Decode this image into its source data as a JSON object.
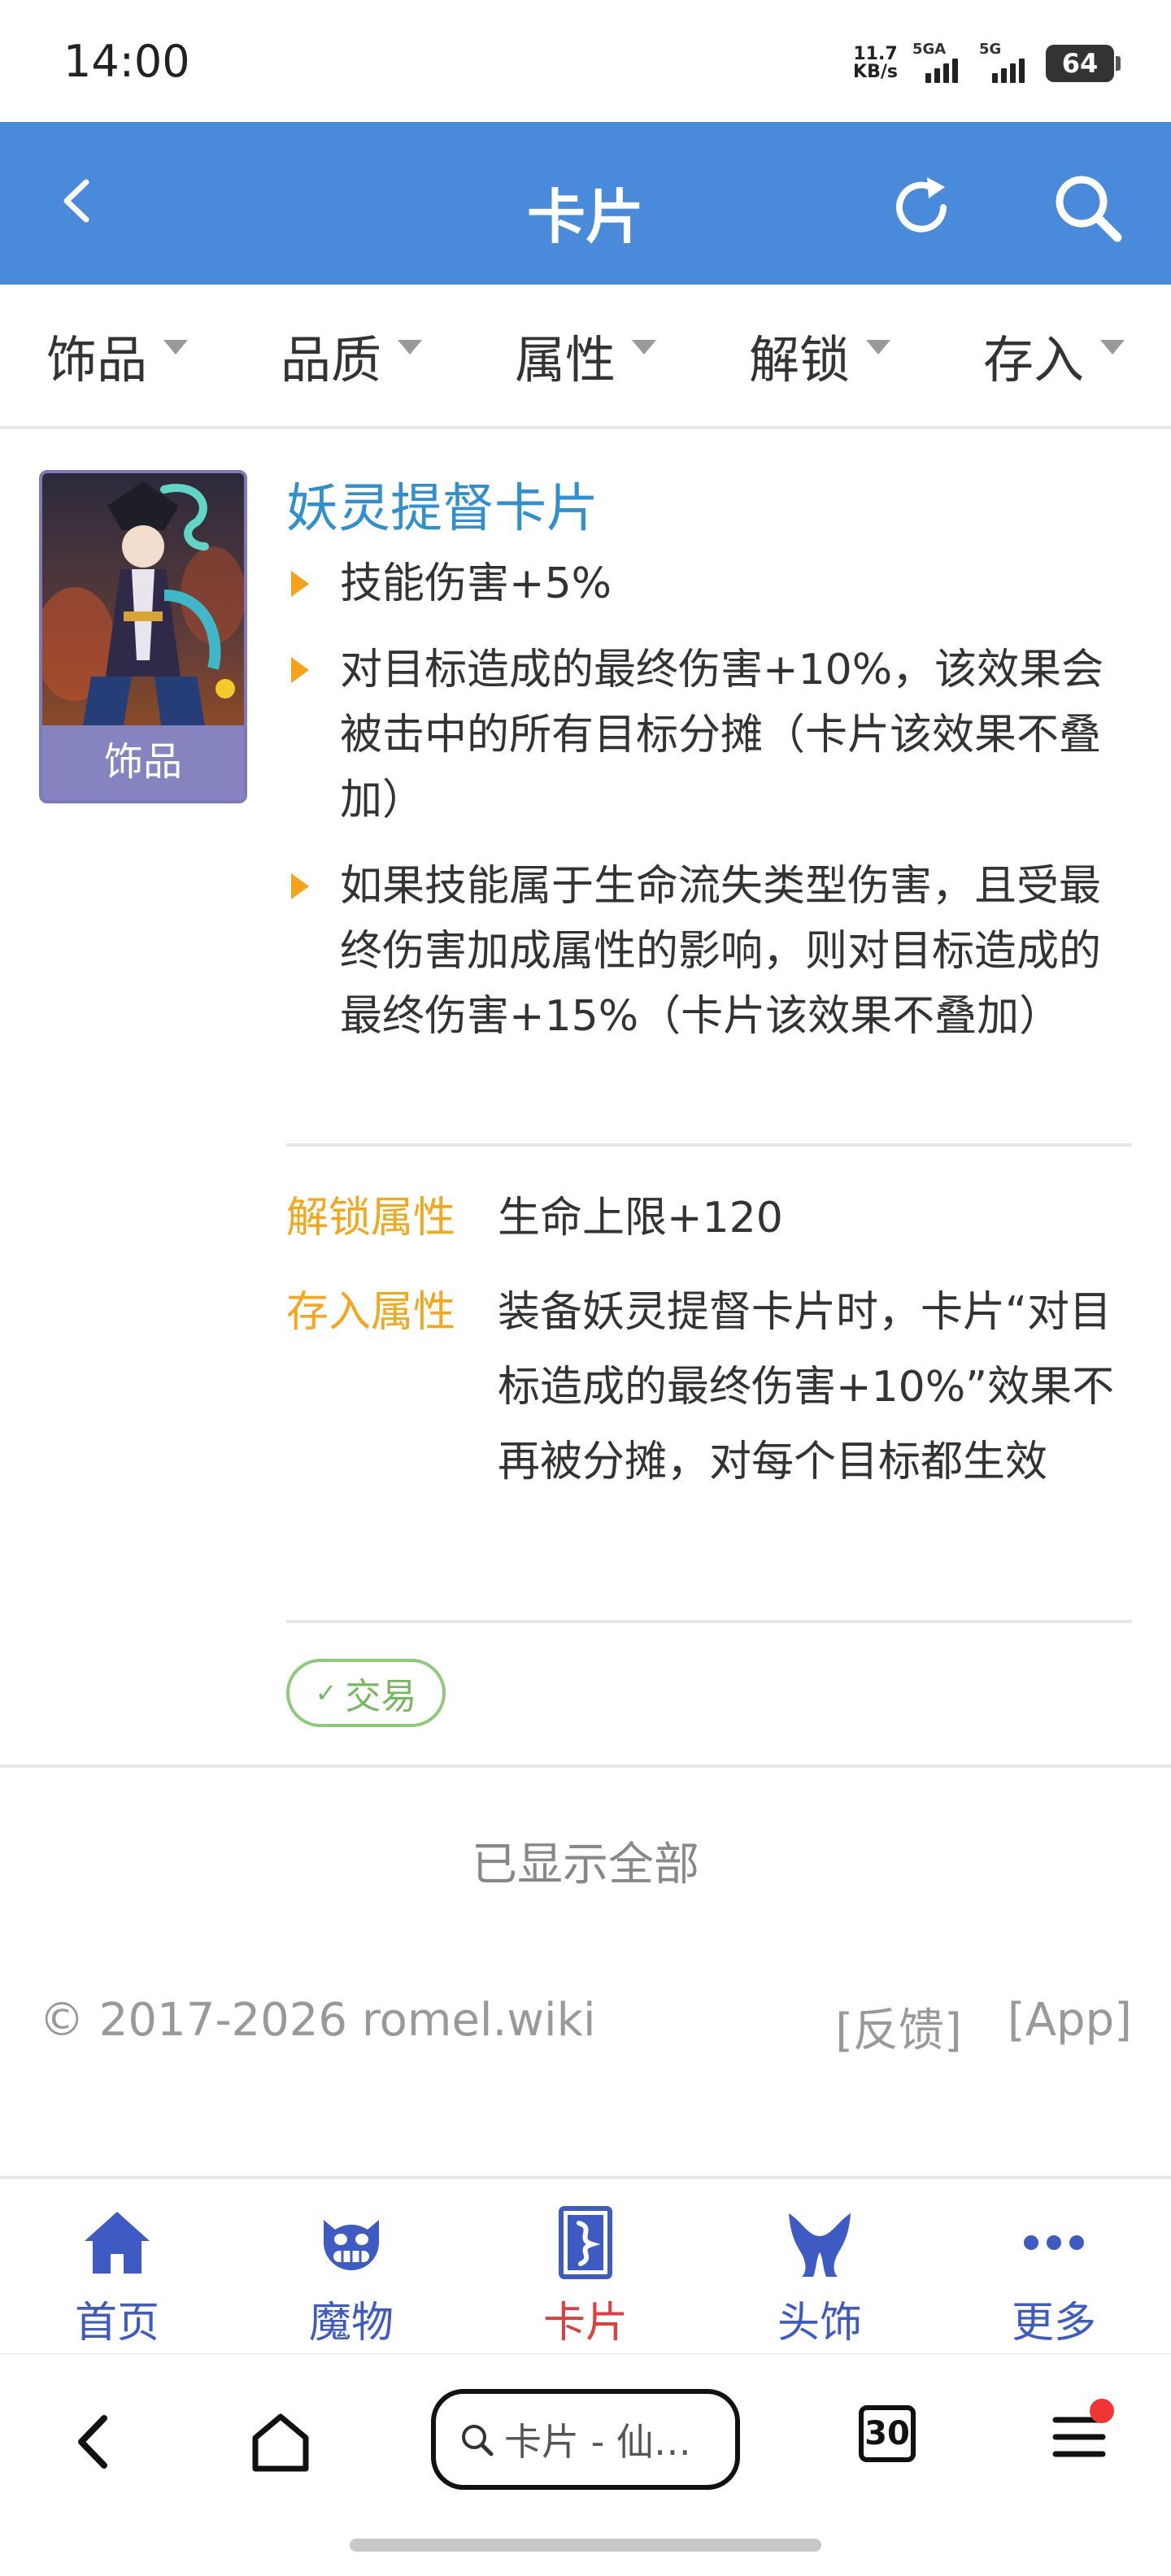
{
  "status_bar": {
    "time": "14:00",
    "net_speed_value": "11.7",
    "net_speed_unit": "KB/s",
    "sim1_label": "5GA",
    "sim2_label": "5G",
    "battery": "64"
  },
  "header": {
    "title": "卡片",
    "back_icon": "chevron-left-icon",
    "refresh_icon": "refresh-icon",
    "search_icon": "search-icon",
    "bg_color": "#4a8ada"
  },
  "filters": [
    {
      "label": "饰品"
    },
    {
      "label": "品质"
    },
    {
      "label": "属性"
    },
    {
      "label": "解锁"
    },
    {
      "label": "存入"
    }
  ],
  "card": {
    "slot_label": "饰品",
    "title": "妖灵提督卡片",
    "effects": [
      "技能伤害+5%",
      "对目标造成的最终伤害+10%，该效果会被击中的所有目标分摊（卡片该效果不叠加）",
      "如果技能属于生命流失类型伤害，且受最终伤害加成属性的影响，则对目标造成的最终伤害+15%（卡片该效果不叠加）"
    ],
    "unlock_attr_label": "解锁属性",
    "unlock_attr_value": "生命上限+120",
    "deposit_attr_label": "存入属性",
    "deposit_attr_value": "装备妖灵提督卡片时，卡片“对目标造成的最终伤害+10%”效果不再被分摊，对每个目标都生效",
    "trade_check": "✓",
    "trade_label": "交易"
  },
  "list_end_text": "已显示全部",
  "footer": {
    "copyright": "© 2017-2026 romel.wiki",
    "feedback_link": "[反馈]",
    "app_link": "[App]"
  },
  "tabbar": [
    {
      "label": "首页",
      "icon": "home-icon"
    },
    {
      "label": "魔物",
      "icon": "monster-icon"
    },
    {
      "label": "卡片",
      "icon": "card-icon",
      "active": true
    },
    {
      "label": "头饰",
      "icon": "headwear-icon"
    },
    {
      "label": "更多",
      "icon": "more-icon"
    }
  ],
  "browser": {
    "url_text": "卡片 - 仙…",
    "tab_count": "30"
  }
}
